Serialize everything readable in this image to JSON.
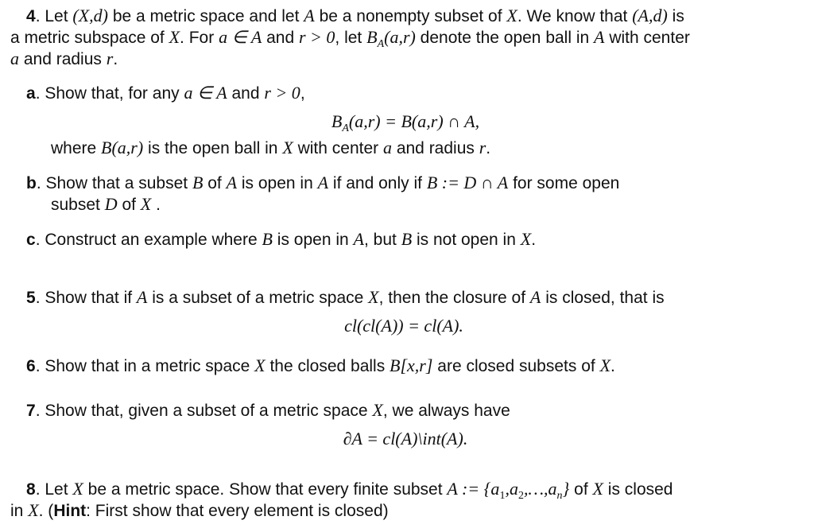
{
  "problems": {
    "p4": {
      "number": "4",
      "line1": {
        "t1": ". Let ",
        "m1": "(X,d)",
        "t2": " be a metric space and let ",
        "m2": "A",
        "t3": " be a nonempty subset of ",
        "m3": "X",
        "t4": ". We know that ",
        "m4": "(A,d)",
        "t5": " is"
      },
      "line2": {
        "t1": "a metric subspace of ",
        "m1": "X",
        "t2": ". For ",
        "m2": "a ∈ A",
        "t3": " and ",
        "m3": "r > 0",
        "t4": ", let ",
        "m4_base": "B",
        "m4_sub": "A",
        "m4_rest": "(a,r)",
        "t5": " denote the open ball in ",
        "m5": "A",
        "t6": " with center"
      },
      "line3": {
        "m1": "a",
        "t1": " and radius ",
        "m2": "r",
        "t2": "."
      },
      "parts": {
        "a": {
          "label": "a",
          "line1": {
            "t1": ". Show that, for any ",
            "m1": "a ∈ A",
            "t2": " and ",
            "m2": "r > 0",
            "t3": ","
          },
          "formula": {
            "lhs_base": "B",
            "lhs_sub": "A",
            "lhs_rest": "(a,r)",
            "rhs": " = B(a,r) ∩ A,"
          },
          "line3": {
            "t1": "where ",
            "m1": "B(a,r)",
            "t2": " is the open ball in ",
            "m2": "X",
            "t3": " with center ",
            "m3": "a",
            "t4": " and radius ",
            "m4": "r",
            "t5": "."
          }
        },
        "b": {
          "label": "b",
          "line1": {
            "t1": ". Show that a subset ",
            "m1": "B",
            "t2": " of ",
            "m2": "A",
            "t3": " is open in ",
            "m3": "A",
            "t4": " if and only if ",
            "m4": "B := D ∩ A",
            "t5": " for some open"
          },
          "line2": {
            "t1": "subset ",
            "m1": "D",
            "t2": " of ",
            "m2": "X",
            "t3": " ."
          }
        },
        "c": {
          "label": "c",
          "line1": {
            "t1": ". Construct an example where ",
            "m1": "B",
            "t2": " is open in ",
            "m2": "A",
            "t3": ", but ",
            "m3": "B",
            "t4": " is not open in ",
            "m4": "X",
            "t5": "."
          }
        }
      }
    },
    "p5": {
      "number": "5",
      "line1": {
        "t1": ". Show that if ",
        "m1": "A",
        "t2": " is a subset of a metric space ",
        "m2": "X",
        "t3": ", then the closure of ",
        "m3": "A",
        "t4": " is closed, that is"
      },
      "formula": "cl(cl(A)) = cl(A)."
    },
    "p6": {
      "number": "6",
      "line1": {
        "t1": ". Show that in a metric space ",
        "m1": "X",
        "t2": " the closed balls ",
        "m2": "B[x,r]",
        "t3": " are closed subsets of ",
        "m3": "X",
        "t4": "."
      }
    },
    "p7": {
      "number": "7",
      "line1": {
        "t1": ". Show that, given a subset of a metric space ",
        "m1": "X",
        "t2": ", we always have"
      },
      "formula": "∂A = cl(A)\\int(A)."
    },
    "p8": {
      "number": "8",
      "line1": {
        "t1": ". Let ",
        "m1": "X",
        "t2": " be a metric space. Show that every finite subset ",
        "m2": "A",
        "m3_pre": " := {a",
        "m3_s1": "1",
        "m3_mid1": ",a",
        "m3_s2": "2",
        "m3_mid2": ",…,a",
        "m3_s3": "n",
        "m3_end": "}",
        "t3": " of ",
        "m4": "X",
        "t4": " is closed"
      },
      "line2": {
        "t1": "in ",
        "m1": "X",
        "t2": ". (",
        "hint_label": "Hint",
        "t3": ": First show that every element is closed)"
      }
    }
  }
}
